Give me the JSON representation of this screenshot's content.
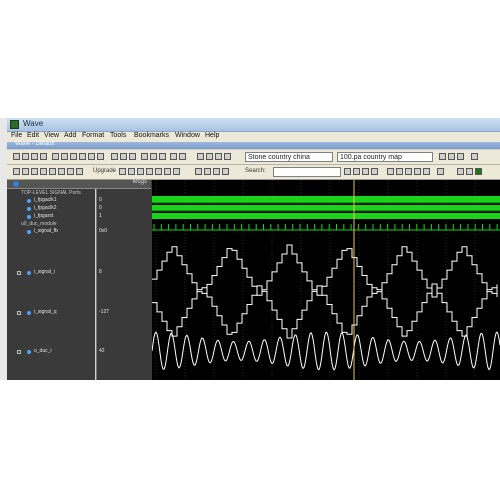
{
  "window": {
    "title": "Wave",
    "subtitle": "Wave - Default"
  },
  "menu": [
    "File",
    "Edit",
    "View",
    "Add",
    "Format",
    "Tools",
    "Bookmarks",
    "Window",
    "Help"
  ],
  "toolbar": {
    "location_combo": "Stone country china",
    "location_combo2": "100.pa country map",
    "upgrade_label": "Upgrade",
    "search_label": "Search:"
  },
  "wave_panel": {
    "msgs_header": "Msgs",
    "groups": [
      {
        "label": "TOP-LEVEL SIGNAL Ports"
      },
      {
        "label": "u0_duc_module"
      }
    ],
    "signals": [
      {
        "name": "i_fpgaclk1",
        "value": "0"
      },
      {
        "name": "i_fpgaclk2",
        "value": "0"
      },
      {
        "name": "i_fpgarst",
        "value": "1"
      },
      {
        "name": "i_signal_fb",
        "value": "0x0"
      },
      {
        "name": "i_signal_i",
        "value": "8"
      },
      {
        "name": "i_signal_q",
        "value": "-127"
      },
      {
        "name": "o_duc_i",
        "value": "42"
      }
    ],
    "colors": {
      "clock": "#19d419",
      "analog": "#ffffff",
      "cursor": "#e8c84a",
      "grid": "#3f5a3f",
      "bg": "#000000"
    }
  }
}
